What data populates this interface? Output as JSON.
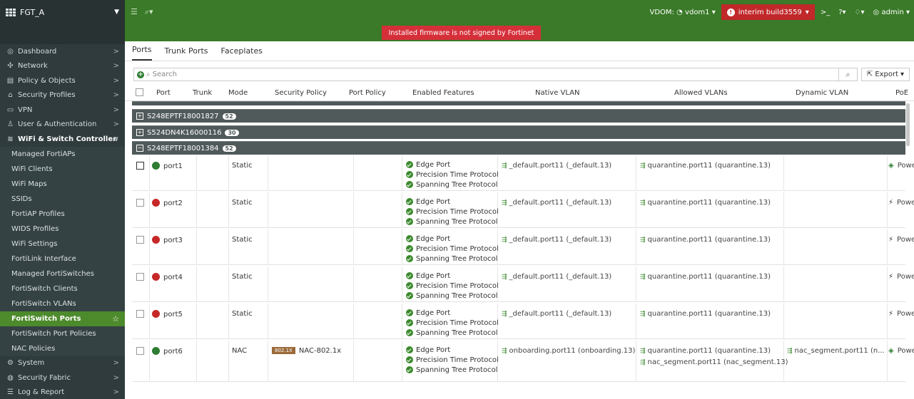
{
  "app": {
    "device": "FGT_A"
  },
  "topbar": {
    "menu_icon": "hamburger-icon",
    "search_icon": "search-icon",
    "vdom_label": "VDOM:",
    "vdom_value": "vdom1",
    "build": "interim build3559",
    "cli_icon": "terminal-icon",
    "help_icon": "help-icon",
    "bell_icon": "bell-icon",
    "user": "admin"
  },
  "banner": "Installed firmware is not signed by Fortinet",
  "sidebar": {
    "top": [
      {
        "icon": "dashboard-icon",
        "label": "Dashboard"
      },
      {
        "icon": "network-icon",
        "label": "Network"
      },
      {
        "icon": "policy-icon",
        "label": "Policy & Objects"
      },
      {
        "icon": "security-icon",
        "label": "Security Profiles"
      },
      {
        "icon": "vpn-icon",
        "label": "VPN"
      },
      {
        "icon": "user-icon",
        "label": "User & Authentication"
      },
      {
        "icon": "wifi-icon",
        "label": "WiFi & Switch Controller"
      }
    ],
    "sub": [
      "Managed FortiAPs",
      "WiFi Clients",
      "WiFi Maps",
      "SSIDs",
      "FortiAP Profiles",
      "WIDS Profiles",
      "WiFi Settings",
      "FortiLink Interface",
      "Managed FortiSwitches",
      "FortiSwitch Clients",
      "FortiSwitch VLANs",
      "FortiSwitch Ports",
      "FortiSwitch Port Policies",
      "NAC Policies"
    ],
    "bottom": [
      {
        "icon": "system-icon",
        "label": "System"
      },
      {
        "icon": "fabric-icon",
        "label": "Security Fabric"
      },
      {
        "icon": "log-icon",
        "label": "Log & Report"
      }
    ]
  },
  "tabs": [
    "Ports",
    "Trunk Ports",
    "Faceplates"
  ],
  "search": {
    "placeholder": "Search",
    "export": "Export"
  },
  "columns": [
    "Port",
    "Trunk",
    "Mode",
    "Security Policy",
    "Port Policy",
    "Enabled Features",
    "Native VLAN",
    "Allowed VLANs",
    "Dynamic VLAN",
    "PoE"
  ],
  "groups": [
    {
      "name": "S248EPTF18001827",
      "count": "52"
    },
    {
      "name": "S524DN4K16000116",
      "count": "30"
    },
    {
      "name": "S248EPTF18001384",
      "count": "52"
    }
  ],
  "features": [
    "Edge Port",
    "Precision Time Protocol",
    "Spanning Tree Protocol"
  ],
  "rows": [
    {
      "port": "port1",
      "status": "up",
      "mode": "Static",
      "policy": "",
      "native": "_default.port11 (_default.13)",
      "allowed1": "quarantine.port11 (quarantine.13)",
      "allowed2": "",
      "dynamic": "",
      "poe": "Powe"
    },
    {
      "port": "port2",
      "status": "down",
      "mode": "Static",
      "policy": "",
      "native": "_default.port11 (_default.13)",
      "allowed1": "quarantine.port11 (quarantine.13)",
      "allowed2": "",
      "dynamic": "",
      "poe": "Powe"
    },
    {
      "port": "port3",
      "status": "down",
      "mode": "Static",
      "policy": "",
      "native": "_default.port11 (_default.13)",
      "allowed1": "quarantine.port11 (quarantine.13)",
      "allowed2": "",
      "dynamic": "",
      "poe": "Powe"
    },
    {
      "port": "port4",
      "status": "down",
      "mode": "Static",
      "policy": "",
      "native": "_default.port11 (_default.13)",
      "allowed1": "quarantine.port11 (quarantine.13)",
      "allowed2": "",
      "dynamic": "",
      "poe": "Powe"
    },
    {
      "port": "port5",
      "status": "down",
      "mode": "Static",
      "policy": "",
      "native": "_default.port11 (_default.13)",
      "allowed1": "quarantine.port11 (quarantine.13)",
      "allowed2": "",
      "dynamic": "",
      "poe": "Powe"
    },
    {
      "port": "port6",
      "status": "up",
      "mode": "NAC",
      "policy_badge": "802.1X",
      "policy": "NAC-802.1x",
      "native": "onboarding.port11 (onboarding.13)",
      "allowed1": "quarantine.port11 (quarantine.13)",
      "allowed2": "nac_segment.port11 (nac_segment.13)",
      "dynamic": "nac_segment.port11 (n...",
      "poe": "Powe"
    }
  ],
  "colors": {
    "accent": "#3a7a28",
    "sidebar": "#2f3b3d",
    "selected": "#4d8a2c",
    "alert": "#d5303a"
  }
}
